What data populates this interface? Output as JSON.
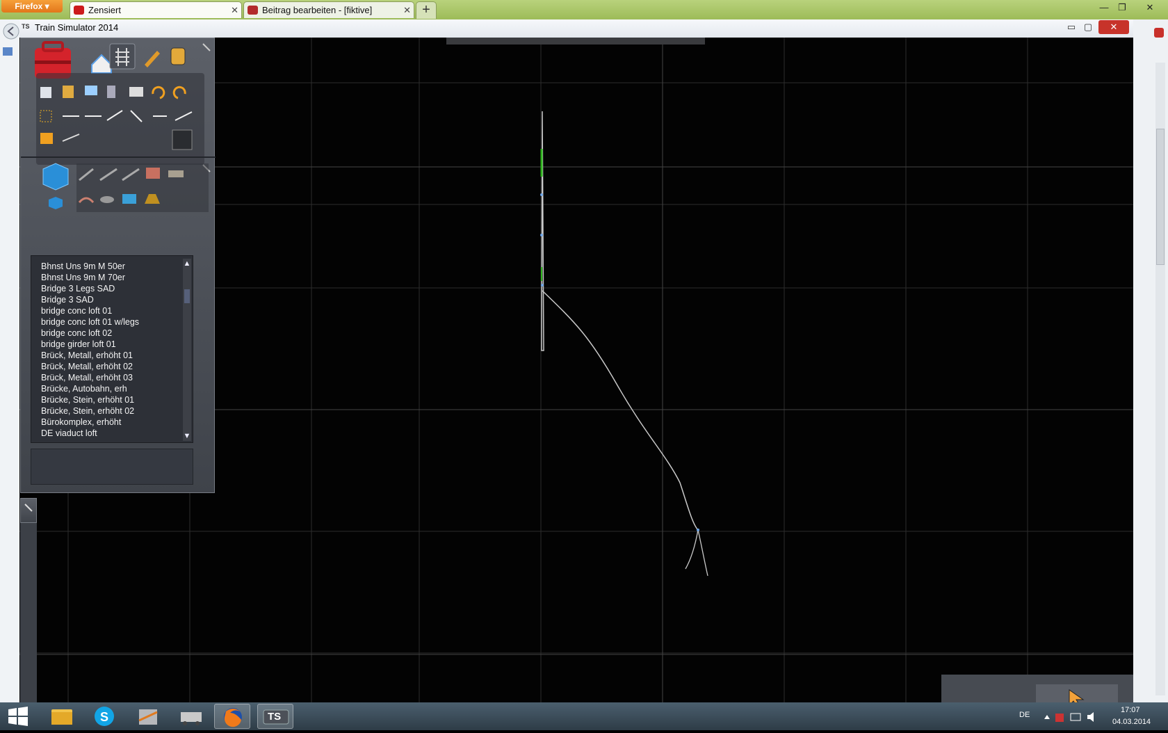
{
  "firefox": {
    "menu_label": "Firefox",
    "tabs": [
      {
        "title": "Zensiert",
        "favicon_color": "#cc1b1b"
      },
      {
        "title": "Beitrag bearbeiten - [fiktive] Emsland...",
        "favicon_color": "#b22b2b"
      }
    ],
    "new_tab_label": "+",
    "controls": {
      "minimize": "—",
      "restore": "❐",
      "close": "✕"
    }
  },
  "ts_window": {
    "logo": "TS",
    "title": "Train Simulator 2014",
    "controls": {
      "minimize": "▭",
      "restore": "▢",
      "close": "✕"
    }
  },
  "editor": {
    "asset_list": [
      "Bhnst Uns 9m M 50er",
      "Bhnst Uns 9m M 70er",
      "Bridge 3 Legs SAD",
      "Bridge 3 SAD",
      "bridge conc loft 01",
      "bridge conc loft 01 w/legs",
      "bridge conc loft 02",
      "bridge girder loft 01",
      "Brück, Metall, erhöht 01",
      "Brück, Metall, erhöht 02",
      "Brück, Metall, erhöht 03",
      "Brücke, Autobahn, erh",
      "Brücke, Stein, erhöht 01",
      "Brücke, Stein, erhöht 02",
      "Bürokomplex, erhöht",
      "DE viaduct loft"
    ],
    "filter_colors": [
      "#c0141a",
      "#3aa21a",
      "#1b5fd6"
    ]
  },
  "taskbar": {
    "language": "DE",
    "time": "17:07",
    "date": "04.03.2014",
    "ts_label": "TS"
  },
  "colors": {
    "track": "#c9c9c9",
    "track_green": "#2fb51e",
    "grid": "#2c2c2c",
    "grid_major": "#3d3d3d"
  }
}
